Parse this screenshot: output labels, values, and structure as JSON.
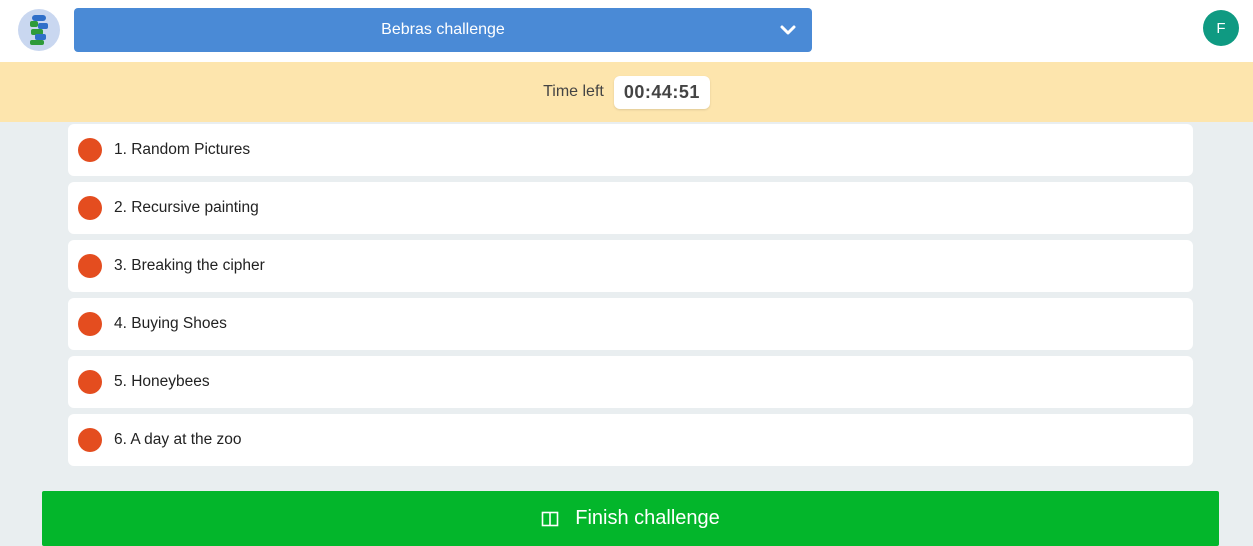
{
  "header": {
    "logo_icon": "bebras-beaver-logo-icon",
    "challenge_title": "Bebras challenge",
    "dropdown_icon": "chevron-down-icon",
    "user_initial": "F",
    "avatar_color": "#0f9a82"
  },
  "timer": {
    "label": "Time left",
    "value": "00:44:51"
  },
  "tasks": [
    {
      "label": "1. Random Pictures",
      "status_color": "#e44d1f"
    },
    {
      "label": "2. Recursive painting",
      "status_color": "#e44d1f"
    },
    {
      "label": "3. Breaking the cipher",
      "status_color": "#e44d1f"
    },
    {
      "label": "4. Buying Shoes",
      "status_color": "#e44d1f"
    },
    {
      "label": "5. Honeybees",
      "status_color": "#e44d1f"
    },
    {
      "label": "6. A day at the zoo",
      "status_color": "#e44d1f"
    }
  ],
  "finish": {
    "label": "Finish challenge",
    "icon": "book-open-icon",
    "color": "#03b62b"
  }
}
